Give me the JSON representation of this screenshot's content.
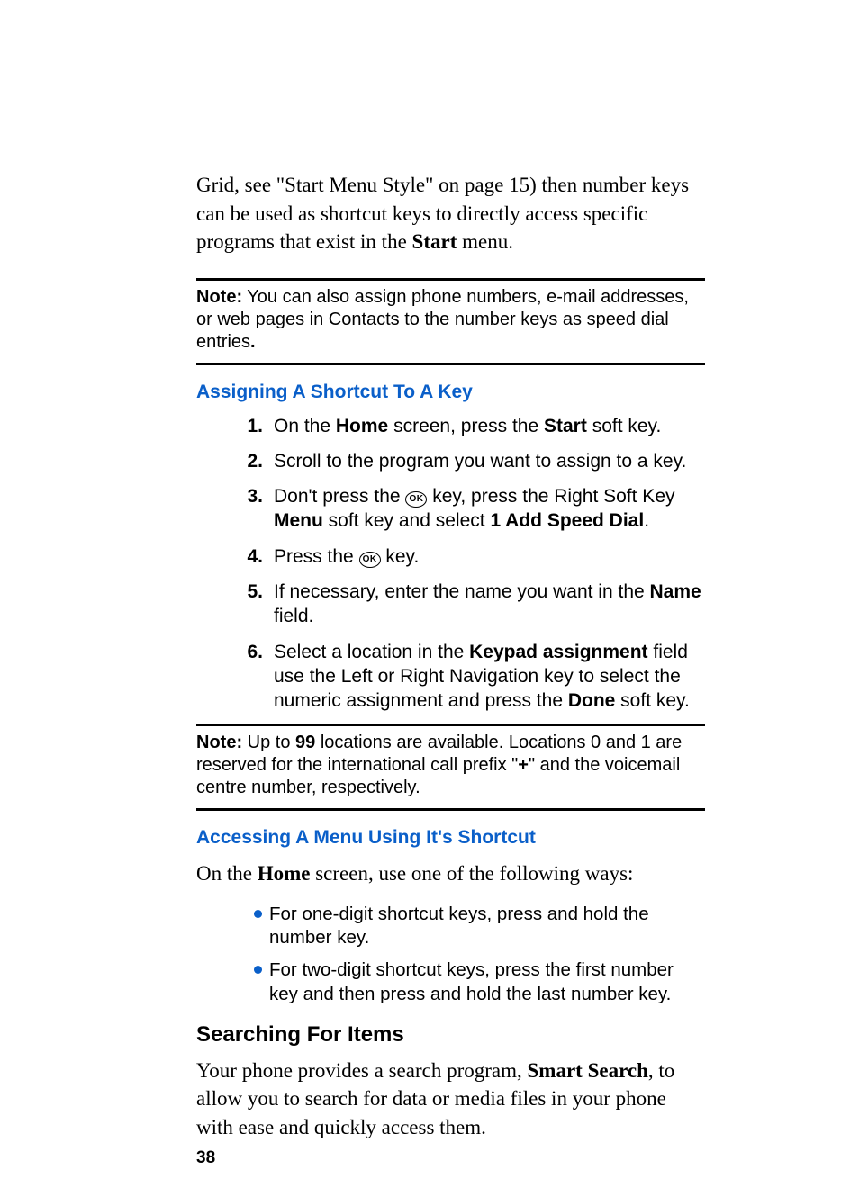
{
  "intro": {
    "pre": "Grid, see \"Start Menu Style\" on page 15) then number keys can be used as shortcut keys to directly access specific programs that exist in the ",
    "bold": "Start",
    "post": " menu."
  },
  "note1": {
    "label": "Note:",
    "text": " You can also assign phone numbers, e-mail addresses, or web pages in Contacts to the number keys as speed dial entries",
    "endbold": "."
  },
  "sectionA": {
    "title": "Assigning A Shortcut To A Key",
    "steps": [
      {
        "n": "1.",
        "seg": [
          "On the ",
          "Home",
          " screen, press the ",
          "Start",
          " soft key."
        ]
      },
      {
        "n": "2.",
        "seg": [
          "Scroll to the program you want to assign to a key."
        ]
      },
      {
        "n": "3.",
        "seg": [
          "Don't press the ",
          "@OK",
          " key, press the Right Soft Key ",
          "Menu",
          " soft key and select ",
          "1 Add Speed Dial",
          "."
        ]
      },
      {
        "n": "4.",
        "seg": [
          "Press the ",
          "@OK",
          " key."
        ]
      },
      {
        "n": "5.",
        "seg": [
          "If necessary, enter the name you want in the ",
          "Name",
          " field."
        ]
      },
      {
        "n": "6.",
        "seg": [
          "Select a location in the ",
          "Keypad assignment",
          " field use the Left or Right Navigation key to select the numeric assignment and press the ",
          "Done",
          " soft key."
        ]
      }
    ]
  },
  "note2": {
    "label": "Note:",
    "seg": [
      " Up to ",
      "99",
      " locations are available. Locations 0 and 1 are reserved for the international call prefix \"",
      "+",
      "\" and the voicemail centre number, respectively."
    ]
  },
  "sectionB": {
    "title": "Accessing A Menu Using It's Shortcut",
    "lead": {
      "pre": "On the ",
      "bold": "Home",
      "post": " screen, use one of the following ways:"
    },
    "bullets": [
      "For one-digit shortcut keys, press and hold the number key.",
      "For two-digit shortcut keys, press the first number key and then press and hold the last number key."
    ]
  },
  "sectionC": {
    "title": "Searching For Items",
    "body": {
      "pre": "Your phone provides a search program, ",
      "bold": "Smart Search",
      "post": ", to allow you to search for data or media files in your phone with ease and quickly access them."
    }
  },
  "pageNumber": "38",
  "okLabel": "OK"
}
